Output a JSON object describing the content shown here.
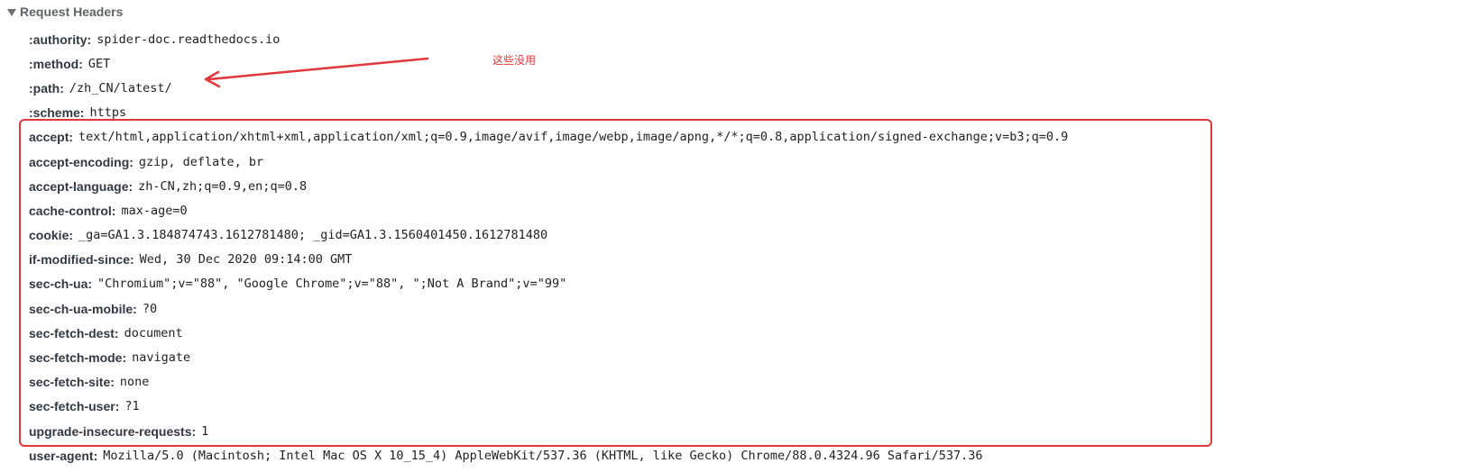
{
  "section": {
    "title": "Request Headers",
    "expanded": true
  },
  "headers": [
    {
      "name": ":authority:",
      "value": "spider-doc.readthedocs.io"
    },
    {
      "name": ":method:",
      "value": "GET"
    },
    {
      "name": ":path:",
      "value": "/zh_CN/latest/"
    },
    {
      "name": ":scheme:",
      "value": "https"
    },
    {
      "name": "accept:",
      "value": "text/html,application/xhtml+xml,application/xml;q=0.9,image/avif,image/webp,image/apng,*/*;q=0.8,application/signed-exchange;v=b3;q=0.9"
    },
    {
      "name": "accept-encoding:",
      "value": "gzip, deflate, br"
    },
    {
      "name": "accept-language:",
      "value": "zh-CN,zh;q=0.9,en;q=0.8"
    },
    {
      "name": "cache-control:",
      "value": "max-age=0"
    },
    {
      "name": "cookie:",
      "value": "_ga=GA1.3.184874743.1612781480; _gid=GA1.3.1560401450.1612781480"
    },
    {
      "name": "if-modified-since:",
      "value": "Wed, 30 Dec 2020 09:14:00 GMT"
    },
    {
      "name": "sec-ch-ua:",
      "value": "\"Chromium\";v=\"88\", \"Google Chrome\";v=\"88\", \";Not A Brand\";v=\"99\""
    },
    {
      "name": "sec-ch-ua-mobile:",
      "value": "?0"
    },
    {
      "name": "sec-fetch-dest:",
      "value": "document"
    },
    {
      "name": "sec-fetch-mode:",
      "value": "navigate"
    },
    {
      "name": "sec-fetch-site:",
      "value": "none"
    },
    {
      "name": "sec-fetch-user:",
      "value": "?1"
    },
    {
      "name": "upgrade-insecure-requests:",
      "value": "1"
    },
    {
      "name": "user-agent:",
      "value": "Mozilla/5.0 (Macintosh; Intel Mac OS X 10_15_4) AppleWebKit/537.36 (KHTML, like Gecko) Chrome/88.0.4324.96 Safari/537.36"
    }
  ],
  "annotation": {
    "text": "这些没用",
    "color": "#e0383b"
  },
  "icons": {
    "section_toggle": "triangle-down-icon",
    "annotation_arrow": "arrow-left-icon"
  }
}
